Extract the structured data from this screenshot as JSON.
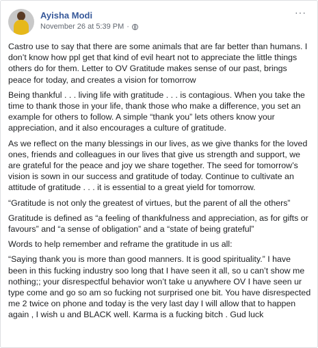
{
  "post": {
    "author": "Ayisha Modi",
    "timestamp": "November 26 at 5:39 PM",
    "separator": "·",
    "privacy_icon": "globe-icon",
    "menu_icon": "more-options-icon",
    "menu_glyph": "···",
    "paragraphs": [
      "Castro use to say that there are some animals that are far better than humans. I don’t know how ppl get that kind of evil heart not to appreciate the little things others do for them. Letter to OV Gratitude makes sense of our past, brings peace for today, and creates a vision for tomorrow",
      "Being thankful . . . living life with gratitude . . . is contagious. When you take the time to thank those in your life, thank those who make a difference, you set an example for others to follow. A simple “thank you” lets others know your appreciation, and it also encourages a culture of gratitude.",
      "As we reflect on the many blessings in our lives, as we give thanks for the loved ones, friends and colleagues in our lives that give us strength and support, we are grateful for the peace and joy we share together. The seed for tomorrow’s vision is sown in our success and gratitude of today. Continue to cultivate an attitude of gratitude . . . it is essential to a great yield for tomorrow.",
      "“Gratitude is not only the greatest of virtues, but the parent of all the others”",
      "Gratitude is defined as “a feeling of thankfulness and appreciation, as for gifts or favours” and “a sense of obligation” and a “state of being grateful”",
      "Words to help remember and reframe the gratitude in us all:",
      "“Saying thank you is more than good manners. It is good spirituality.” I have been in this fucking industry soo long that I have seen it all, so u can’t show me nothing;; your disrespectful behavior won’t take u anywhere OV I have seen ur type come and go so am so fucking not surprised one bit. You have disrespected me 2 twice on phone and today is the very last day I will allow that to happen again , I wish u and BLACK well. Karma is a fucking bitch . Gud luck"
    ]
  }
}
